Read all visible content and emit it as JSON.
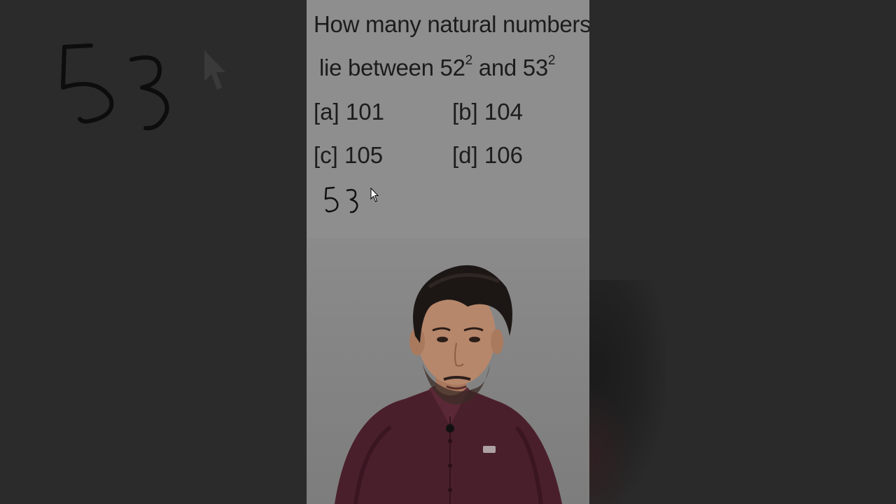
{
  "question": {
    "line1": "How many natural numbers",
    "line2_prefix": "lie between 52",
    "line2_exp1": "2",
    "line2_mid": " and 53",
    "line2_exp2": "2"
  },
  "options": {
    "a": "[a] 101",
    "b": "[b] 104",
    "c": "[c] 105",
    "d": "[d] 106"
  },
  "handwriting": "53",
  "icons": [
    "mouse-cursor-icon",
    "microphone-icon"
  ],
  "colors": {
    "slide_bg": "#8e8e8e",
    "text": "#1c1c1c",
    "side_bg": "#2b2b2b",
    "shirt": "#4a1f2c"
  }
}
